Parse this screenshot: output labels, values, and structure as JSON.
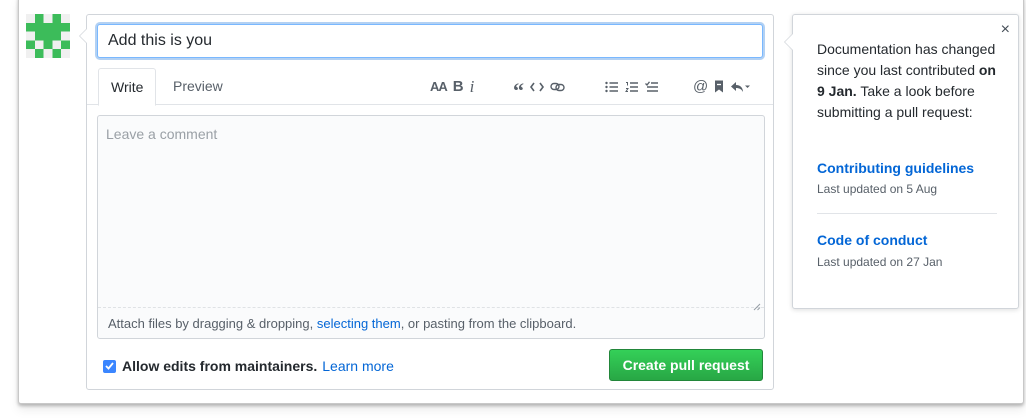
{
  "title_input": {
    "value": "Add this is you"
  },
  "tabs": [
    {
      "label": "Write"
    },
    {
      "label": "Preview"
    }
  ],
  "toolbar": {
    "icons": [
      "header-icon",
      "bold-icon",
      "italic-icon",
      "quote-icon",
      "code-icon",
      "link-icon",
      "unordered-list-icon",
      "ordered-list-icon",
      "task-list-icon",
      "mention-icon",
      "reference-icon",
      "saved-reply-icon"
    ],
    "header_label": "AA",
    "bold_label": "B",
    "italic_label": "i",
    "quote_label": "“",
    "mention_label": "@"
  },
  "comment": {
    "placeholder": "Leave a comment",
    "attach_prefix": "Attach files by dragging & dropping, ",
    "attach_link": "selecting them",
    "attach_suffix": ", or pasting from the clipboard."
  },
  "footer": {
    "allow_edits_checked": true,
    "allow_edits_label": "Allow edits from maintainers.",
    "learn_more": "Learn more",
    "create_button": "Create pull request"
  },
  "popover": {
    "close": "×",
    "msg_part1": "Documentation has changed since you last contributed ",
    "msg_bold": "on 9 Jan.",
    "msg_part2": " Take a look before submitting a pull request:",
    "docs": [
      {
        "label": "Contributing guidelines",
        "updated": "Last updated on 5 Aug"
      },
      {
        "label": "Code of conduct",
        "updated": "Last updated on 27 Jan"
      }
    ]
  },
  "colors": {
    "accent": "#0366d6",
    "primary_button": "#28a745",
    "avatar": "#3cbc5a"
  }
}
